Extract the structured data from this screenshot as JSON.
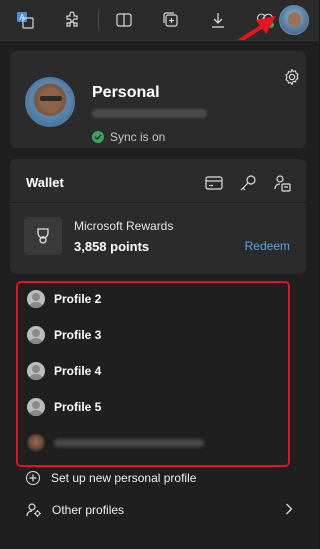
{
  "toolbar": {
    "icons": [
      "translate-icon",
      "extensions-icon",
      "split-screen-icon",
      "collections-icon",
      "downloads-icon",
      "browser-essentials-icon",
      "profile-avatar-icon"
    ]
  },
  "profile": {
    "name": "Personal",
    "email": "",
    "sync_status": "Sync is on"
  },
  "wallet": {
    "title": "Wallet",
    "rewards_name": "Microsoft Rewards",
    "rewards_points": "3,858 points",
    "redeem_label": "Redeem"
  },
  "profiles": {
    "items": [
      {
        "label": "Profile 2"
      },
      {
        "label": "Profile 3"
      },
      {
        "label": "Profile 4"
      },
      {
        "label": "Profile 5"
      }
    ]
  },
  "actions": {
    "setup_label": "Set up new personal profile",
    "other_label": "Other profiles"
  },
  "colors": {
    "accent_link": "#5aa3e6",
    "sync_green": "#3aa55d",
    "highlight_red": "#e0141e"
  }
}
